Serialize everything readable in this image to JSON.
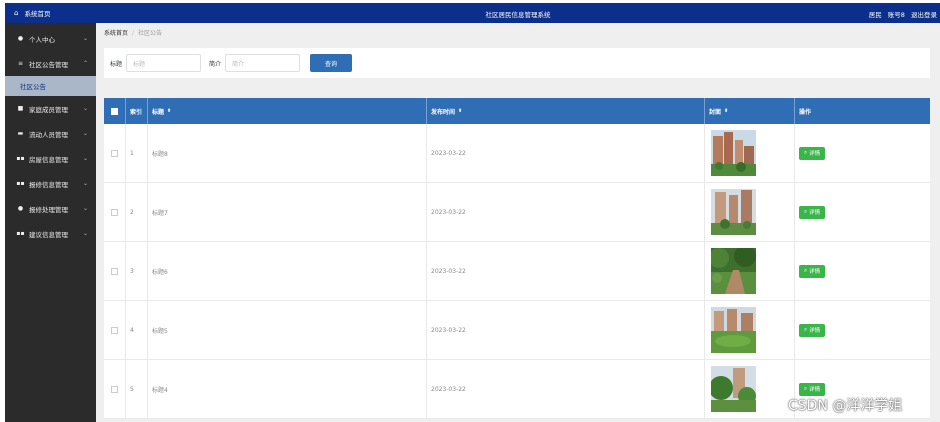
{
  "sidebar": {
    "home": "系统首页",
    "items": [
      {
        "icon": "user-icon",
        "glyph": "👤",
        "label": "个人中心"
      },
      {
        "icon": "list-icon",
        "glyph": "≡",
        "label": "社区公告管理"
      },
      {
        "icon": "clipboard-icon",
        "glyph": "▣",
        "label": "家庭成员管理"
      },
      {
        "icon": "chat-icon",
        "glyph": "▬",
        "label": "流动人员管理"
      },
      {
        "icon": "grid-icon",
        "glyph": "▪▪",
        "label": "房屋信息管理"
      },
      {
        "icon": "grid-icon",
        "glyph": "▪▪",
        "label": "报修信息管理"
      },
      {
        "icon": "pin-icon",
        "glyph": "●",
        "label": "报修处理管理"
      },
      {
        "icon": "grid-icon",
        "glyph": "▪▪",
        "label": "建议信息管理"
      }
    ],
    "sub_active": "社区公告"
  },
  "header": {
    "title": "社区居民信息管理系统",
    "role": "居民",
    "account": "账号8",
    "logout": "退出登录"
  },
  "breadcrumb": {
    "home": "系统首页",
    "current": "社区公告"
  },
  "search": {
    "title_label": "标题",
    "title_placeholder": "标题",
    "intro_label": "简介",
    "intro_placeholder": "简介",
    "button": "查询"
  },
  "table": {
    "headers": {
      "index": "索引",
      "title": "标题",
      "date": "发布时间",
      "cover": "封面",
      "action": "操作"
    },
    "detail_label": "详情",
    "rows": [
      {
        "index": "1",
        "title": "标题8",
        "date": "2023-03-22"
      },
      {
        "index": "2",
        "title": "标题7",
        "date": "2023-03-22"
      },
      {
        "index": "3",
        "title": "标题6",
        "date": "2023-03-22"
      },
      {
        "index": "4",
        "title": "标题5",
        "date": "2023-03-22"
      },
      {
        "index": "5",
        "title": "标题4",
        "date": "2023-03-22"
      }
    ]
  },
  "watermark": "CSDN @洋洋学姐",
  "colors": {
    "primary": "#0b2f8a",
    "table_header": "#2f6db5",
    "success": "#39b54a",
    "sidebar": "#2b2b2b"
  }
}
